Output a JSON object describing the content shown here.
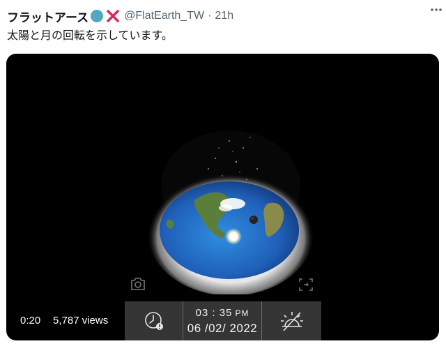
{
  "tweet": {
    "author_name": "フラットアース",
    "handle": "@FlatEarth_TW",
    "separator": "·",
    "time": "21h",
    "text": "太陽と月の回転を示しています。"
  },
  "media": {
    "playtime": "0:20",
    "views": "5,787 views",
    "overlay": {
      "time": "03 : 35",
      "ampm": "PM",
      "date": "06 /02/ 2022"
    }
  },
  "icons": {
    "author_badges": [
      "globe-icon",
      "x-mark-icon"
    ],
    "more": "more-icon",
    "camera": "camera-icon",
    "expand": "expand-icon",
    "clock": "clock-icon",
    "sun_off": "sun-off-icon"
  },
  "colors": {
    "text": "#0f1419",
    "secondary": "#536471",
    "media_bg": "#000000",
    "overlay_bg": "#3a3a3a",
    "x_mark": "#e0245e"
  }
}
